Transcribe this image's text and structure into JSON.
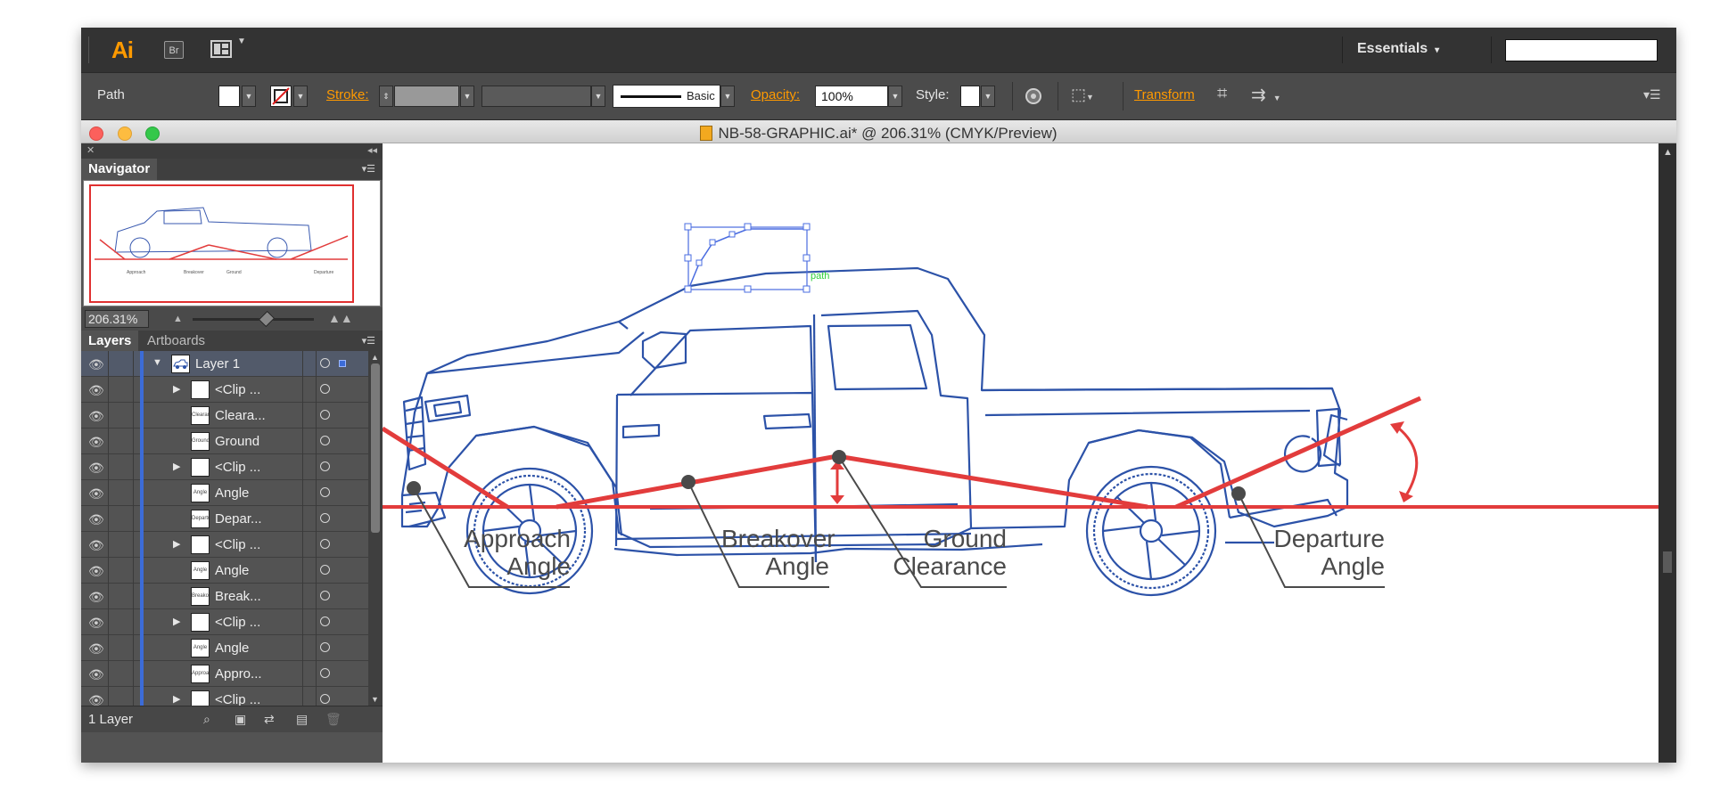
{
  "app": {
    "logo": "Ai",
    "bridge_label": "Br",
    "workspace": "Essentials",
    "workspace_chevron": "▾"
  },
  "control_bar": {
    "selection_type": "Path",
    "stroke_label": "Stroke:",
    "brush_label": "Basic",
    "opacity_label": "Opacity:",
    "opacity_value": "100%",
    "style_label": "Style:",
    "transform_label": "Transform"
  },
  "document": {
    "title": "NB-58-GRAPHIC.ai* @ 206.31% (CMYK/Preview)"
  },
  "navigator": {
    "tab_label": "Navigator",
    "zoom_value": "206.31%",
    "zoom_slider_fraction": 0.6
  },
  "layers_panel": {
    "tabs": [
      {
        "label": "Layers",
        "active": true
      },
      {
        "label": "Artboards",
        "active": false
      }
    ],
    "rows": [
      {
        "name": "Layer 1",
        "level": 0,
        "expanded": true,
        "thumb": "truck"
      },
      {
        "name": "<Clip ...",
        "level": 1,
        "expandable": true,
        "thumb": ""
      },
      {
        "name": "Cleara...",
        "level": 1,
        "thumb": "Clearance"
      },
      {
        "name": "Ground",
        "level": 1,
        "thumb": "Ground"
      },
      {
        "name": "<Clip ...",
        "level": 1,
        "expandable": true,
        "thumb": ""
      },
      {
        "name": "Angle",
        "level": 1,
        "thumb": "Angle"
      },
      {
        "name": "Depar...",
        "level": 1,
        "thumb": "Departure"
      },
      {
        "name": "<Clip ...",
        "level": 1,
        "expandable": true,
        "thumb": ""
      },
      {
        "name": "Angle",
        "level": 1,
        "thumb": "Angle"
      },
      {
        "name": "Break...",
        "level": 1,
        "thumb": "Breakover"
      },
      {
        "name": "<Clip ...",
        "level": 1,
        "expandable": true,
        "thumb": ""
      },
      {
        "name": "Angle",
        "level": 1,
        "thumb": "Angle"
      },
      {
        "name": "Appro...",
        "level": 1,
        "thumb": "Approach"
      },
      {
        "name": "<Clip ...",
        "level": 1,
        "expandable": true,
        "thumb": ""
      }
    ],
    "footer_count": "1 Layer"
  },
  "artwork": {
    "path_label": "path",
    "callouts": {
      "approach": [
        "Approach",
        "Angle"
      ],
      "breakover": [
        "Breakover",
        "Angle"
      ],
      "ground": [
        "Ground",
        "Clearance"
      ],
      "departure": [
        "Departure",
        "Angle"
      ]
    },
    "colors": {
      "line_art": "#2c52a8",
      "measure": "#e23c3c",
      "callout_text": "#4a4a4a"
    }
  },
  "colors": {
    "app_bar": "#333333",
    "panel_bg": "#535353",
    "accent": "#ff9a00",
    "selection": "#3c6cd8"
  }
}
